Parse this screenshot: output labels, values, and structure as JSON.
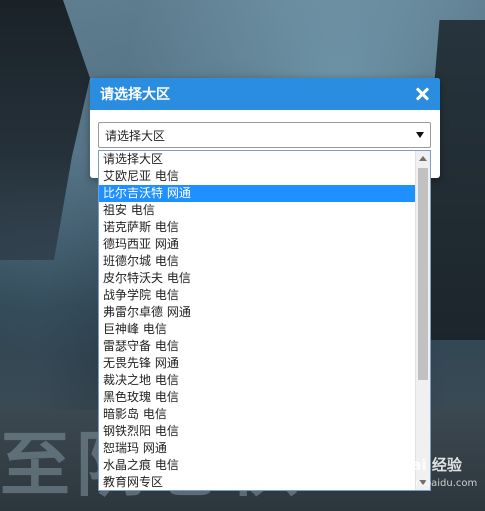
{
  "dialog": {
    "title": "请选择大区",
    "close_icon": "close-icon"
  },
  "select": {
    "value": "请选择大区",
    "arrow_icon": "dropdown-arrow-icon"
  },
  "dropdown": {
    "selected_index": 2,
    "options": [
      "请选择大区",
      "艾欧尼亚 电信",
      "比尔吉沃特 网通",
      "祖安 电信",
      "诺克萨斯 电信",
      "德玛西亚 网通",
      "班德尔城 电信",
      "皮尔特沃夫 电信",
      "战争学院 电信",
      "弗雷尔卓德 网通",
      "巨神峰 电信",
      "雷瑟守备 电信",
      "无畏先锋 网通",
      "裁决之地 电信",
      "黑色玫瑰 电信",
      "暗影岛 电信",
      "钢铁烈阳 电信",
      "恕瑞玛 网通",
      "水晶之痕 电信",
      "教育网专区"
    ]
  },
  "background": {
    "banner_text": "至阴卷棋"
  },
  "watermark": {
    "brand": "Bai 经验",
    "url": "jingyan.baidu.com"
  },
  "colors": {
    "header_blue": "#2b8de0",
    "selected_blue": "#1e90ff"
  }
}
